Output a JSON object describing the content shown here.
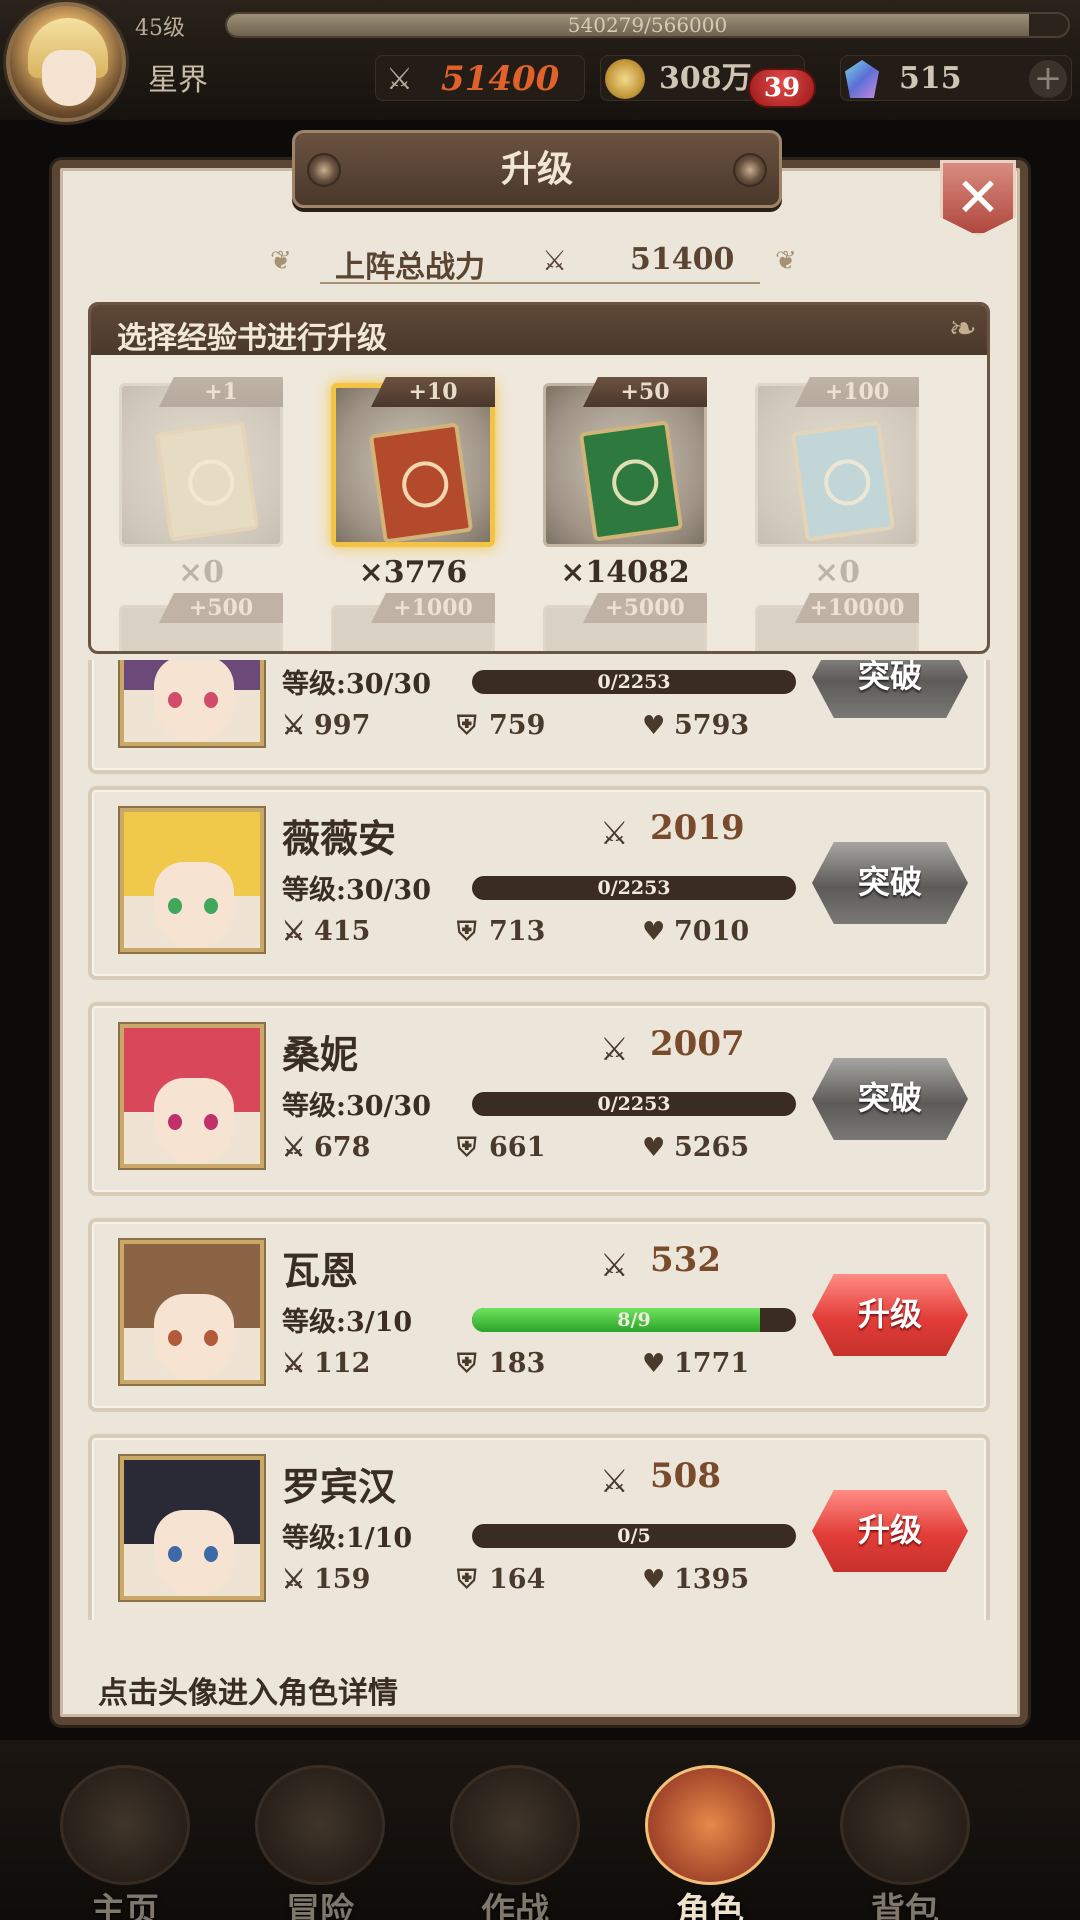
{
  "player": {
    "level_text": "45级",
    "exp_text": "540279/566000",
    "exp_fraction": 0.954,
    "name": "星界",
    "power": "51400",
    "gold": "308万",
    "notification_count": "39",
    "gems": "515"
  },
  "panel": {
    "title": "升级",
    "total_power_label": "上阵总战力",
    "total_power_value": "51400",
    "book_header": "选择经验书进行升级",
    "books": [
      {
        "tag": "+1",
        "count": "×0",
        "state": "disabled",
        "color": "#d8c79a"
      },
      {
        "tag": "+10",
        "count": "×3776",
        "state": "selected",
        "color": "#b34a2c"
      },
      {
        "tag": "+50",
        "count": "×14082",
        "state": "normal",
        "color": "#2e7a3e"
      },
      {
        "tag": "+100",
        "count": "×0",
        "state": "disabled",
        "color": "#6fb4cf"
      }
    ],
    "books_row2": [
      "+500",
      "+1000",
      "+5000",
      "+10000"
    ],
    "hint": "点击头像进入角色详情"
  },
  "heroes": [
    {
      "name": "",
      "power": "",
      "level": "等级:30/30",
      "xp_text": "0/2253",
      "xp_fraction": 0,
      "atk": "997",
      "def": "759",
      "hp": "5793",
      "action": "突破",
      "action_type": "breakthrough",
      "hair": "#6b4a7a",
      "eye": "#d24b6a"
    },
    {
      "name": "薇薇安",
      "power": "2019",
      "level": "等级:30/30",
      "xp_text": "0/2253",
      "xp_fraction": 0,
      "atk": "415",
      "def": "713",
      "hp": "7010",
      "action": "突破",
      "action_type": "breakthrough",
      "hair": "#f0c84a",
      "eye": "#3fa85a"
    },
    {
      "name": "桑妮",
      "power": "2007",
      "level": "等级:30/30",
      "xp_text": "0/2253",
      "xp_fraction": 0,
      "atk": "678",
      "def": "661",
      "hp": "5265",
      "action": "突破",
      "action_type": "breakthrough",
      "hair": "#d9485a",
      "eye": "#c0306a"
    },
    {
      "name": "瓦恩",
      "power": "532",
      "level": "等级:3/10",
      "xp_text": "8/9",
      "xp_fraction": 0.889,
      "atk": "112",
      "def": "183",
      "hp": "1771",
      "action": "升级",
      "action_type": "upgrade",
      "hair": "#8a6444",
      "eye": "#b25a3a"
    },
    {
      "name": "罗宾汉",
      "power": "508",
      "level": "等级:1/10",
      "xp_text": "0/5",
      "xp_fraction": 0,
      "atk": "159",
      "def": "164",
      "hp": "1395",
      "action": "升级",
      "action_type": "upgrade",
      "hair": "#2a2a36",
      "eye": "#3c6aa8"
    }
  ],
  "nav": [
    {
      "label": "主页",
      "active": false
    },
    {
      "label": "冒险",
      "active": false
    },
    {
      "label": "作战",
      "active": false
    },
    {
      "label": "角色",
      "active": true
    },
    {
      "label": "背包",
      "active": false
    }
  ]
}
